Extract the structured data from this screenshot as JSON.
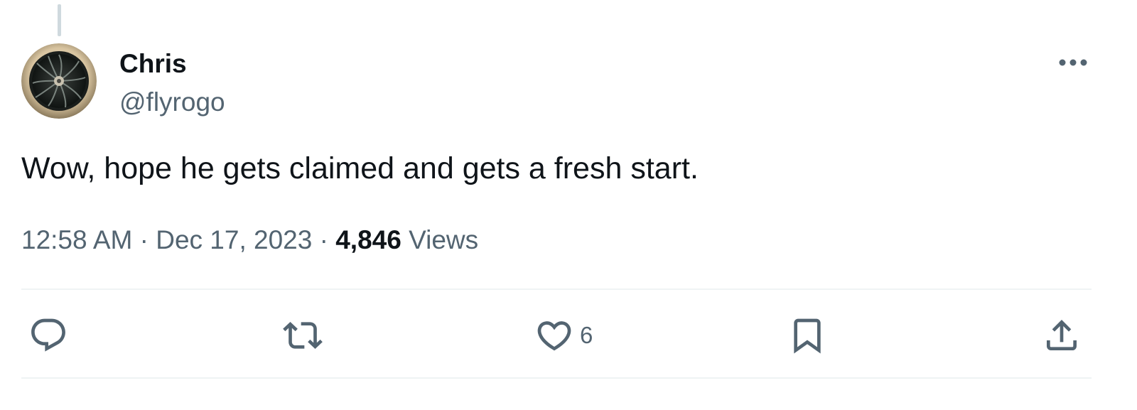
{
  "tweet": {
    "author": {
      "display_name": "Chris",
      "handle": "@flyrogo",
      "avatar_icon": "jet-engine-avatar"
    },
    "text": "Wow, hope he gets claimed and gets a fresh start.",
    "time": "12:58 AM",
    "date": "Dec 17, 2023",
    "separator": "·",
    "views_count": "4,846",
    "views_label": "Views"
  },
  "actions": {
    "reply": {
      "icon": "reply-icon"
    },
    "retweet": {
      "icon": "retweet-icon"
    },
    "like": {
      "icon": "heart-icon",
      "count": "6"
    },
    "bookmark": {
      "icon": "bookmark-icon"
    },
    "share": {
      "icon": "share-icon"
    },
    "more": {
      "icon": "more-dots-icon"
    }
  },
  "colors": {
    "text_primary": "#0f1419",
    "text_secondary": "#536471",
    "divider": "#eff3f4"
  }
}
